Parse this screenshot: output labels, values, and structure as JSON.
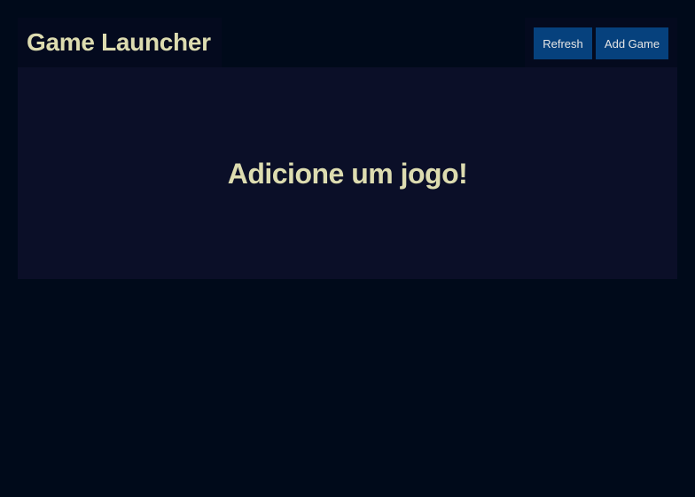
{
  "header": {
    "title": "Game Launcher",
    "refresh_label": "Refresh",
    "add_game_label": "Add Game"
  },
  "main": {
    "empty_message": "Adicione um jogo!"
  },
  "colors": {
    "page_background": "#000a1a",
    "panel_background": "#0b0f28",
    "header_background": "#040a1e",
    "button_background": "#06417d",
    "title_text": "#dddcb0",
    "button_text": "#e6e6e6"
  }
}
